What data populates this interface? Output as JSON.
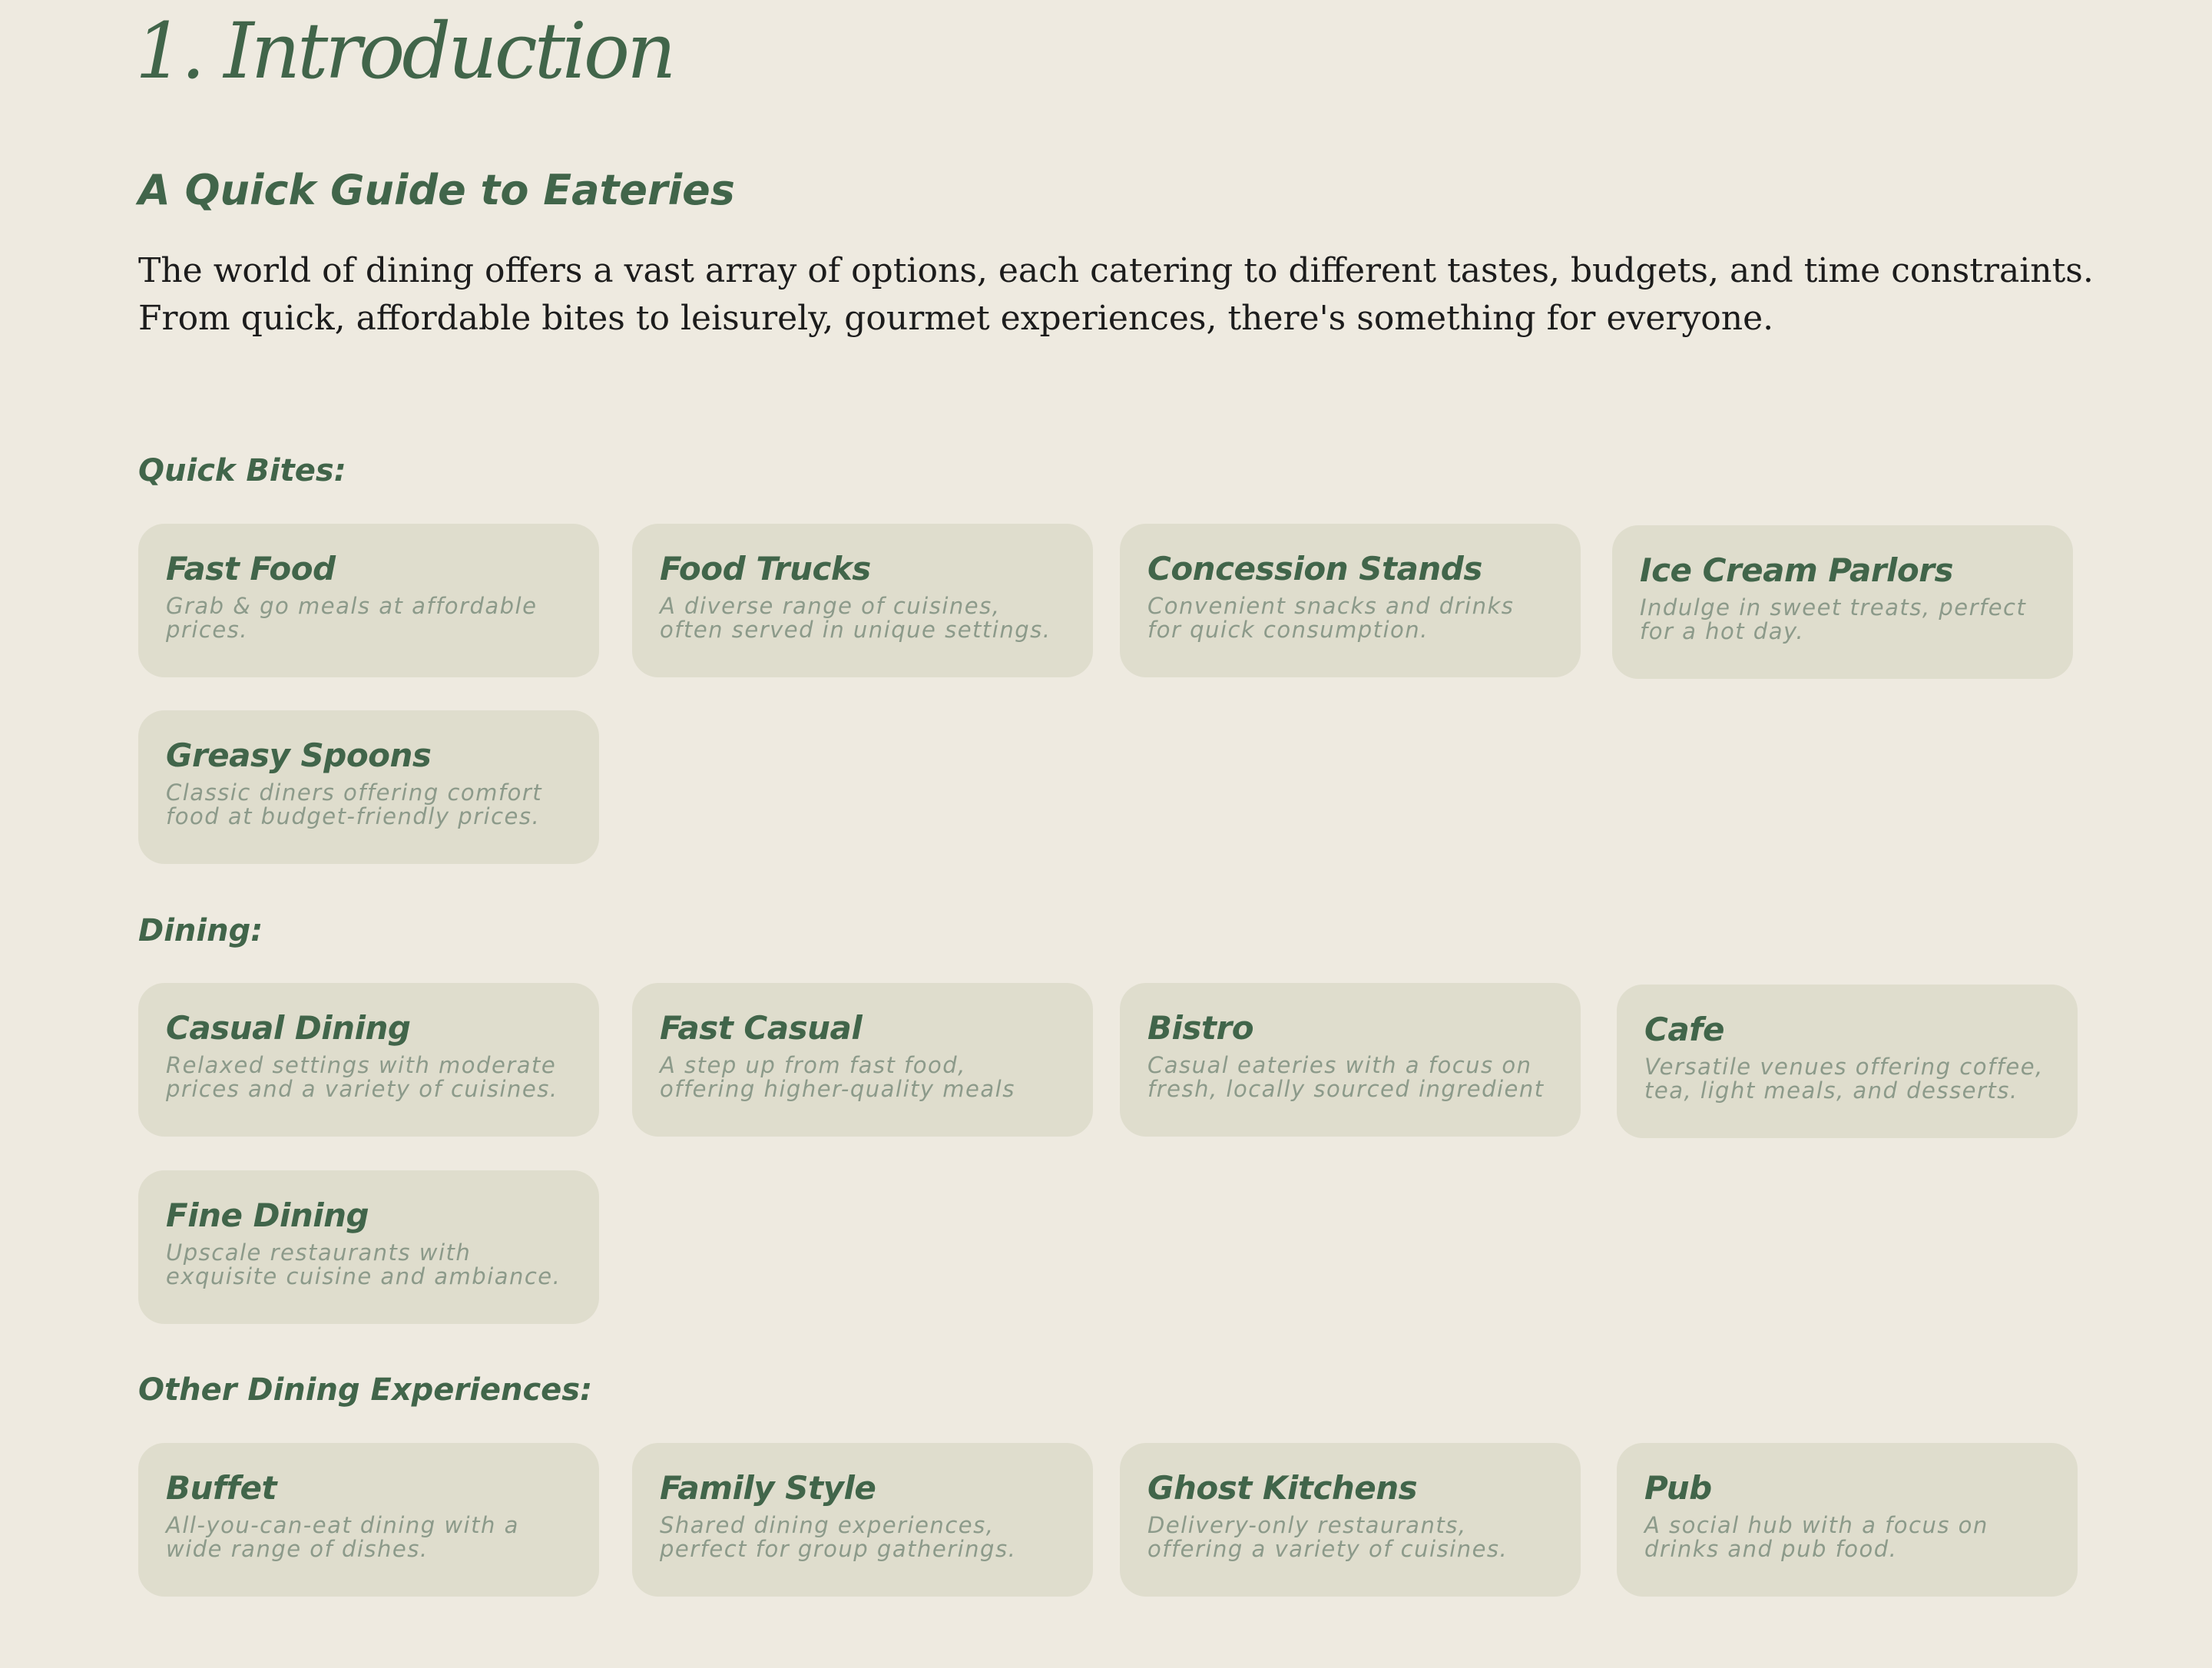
{
  "header": {
    "title": "1. Introduction",
    "subtitle": "A Quick Guide to Eateries"
  },
  "intro": {
    "text": "The world of dining offers a vast array of options, each catering to different tastes, budgets, and time constraints. From quick, affordable bites to leisurely, gourmet experiences, there's something for everyone."
  },
  "sections": [
    {
      "label": "Quick Bites:",
      "cards": [
        {
          "title": "Fast Food",
          "desc": "Grab & go meals at affordable prices."
        },
        {
          "title": "Food Trucks",
          "desc": "A diverse range of cuisines, often served in unique settings."
        },
        {
          "title": "Concession Stands",
          "desc": "Convenient snacks and drinks for quick consumption."
        },
        {
          "title": "Ice Cream Parlors",
          "desc": "Indulge in sweet treats, perfect for a hot day."
        },
        {
          "title": "Greasy Spoons",
          "desc": "Classic diners offering comfort food at budget-friendly prices."
        }
      ]
    },
    {
      "label": "Dining:",
      "cards": [
        {
          "title": "Casual Dining",
          "desc": "Relaxed settings with moderate prices and a variety of cuisines."
        },
        {
          "title": "Fast Casual",
          "desc": "A step up from fast food, offering higher-quality meals"
        },
        {
          "title": "Bistro",
          "desc": "Casual eateries with a focus on fresh, locally sourced ingredient"
        },
        {
          "title": "Cafe",
          "desc": "Versatile venues offering coffee, tea, light meals, and desserts."
        },
        {
          "title": "Fine Dining",
          "desc": "Upscale restaurants with exquisite cuisine and ambiance."
        }
      ]
    },
    {
      "label": "Other Dining Experiences:",
      "cards": [
        {
          "title": "Buffet",
          "desc": "All-you-can-eat dining with a wide range of dishes."
        },
        {
          "title": "Family Style",
          "desc": "Shared dining experiences, perfect for group gatherings."
        },
        {
          "title": "Ghost Kitchens",
          "desc": "Delivery-only restaurants, offering a variety of cuisines."
        },
        {
          "title": "Pub",
          "desc": "A social hub with a focus on drinks and pub food."
        }
      ]
    }
  ],
  "colors": {
    "background": "#eeeae0",
    "accent_green": "#41654a",
    "card_background": "#dfddcd",
    "card_text_muted": "#8c9a8a",
    "body_text": "#1c1c1c"
  }
}
